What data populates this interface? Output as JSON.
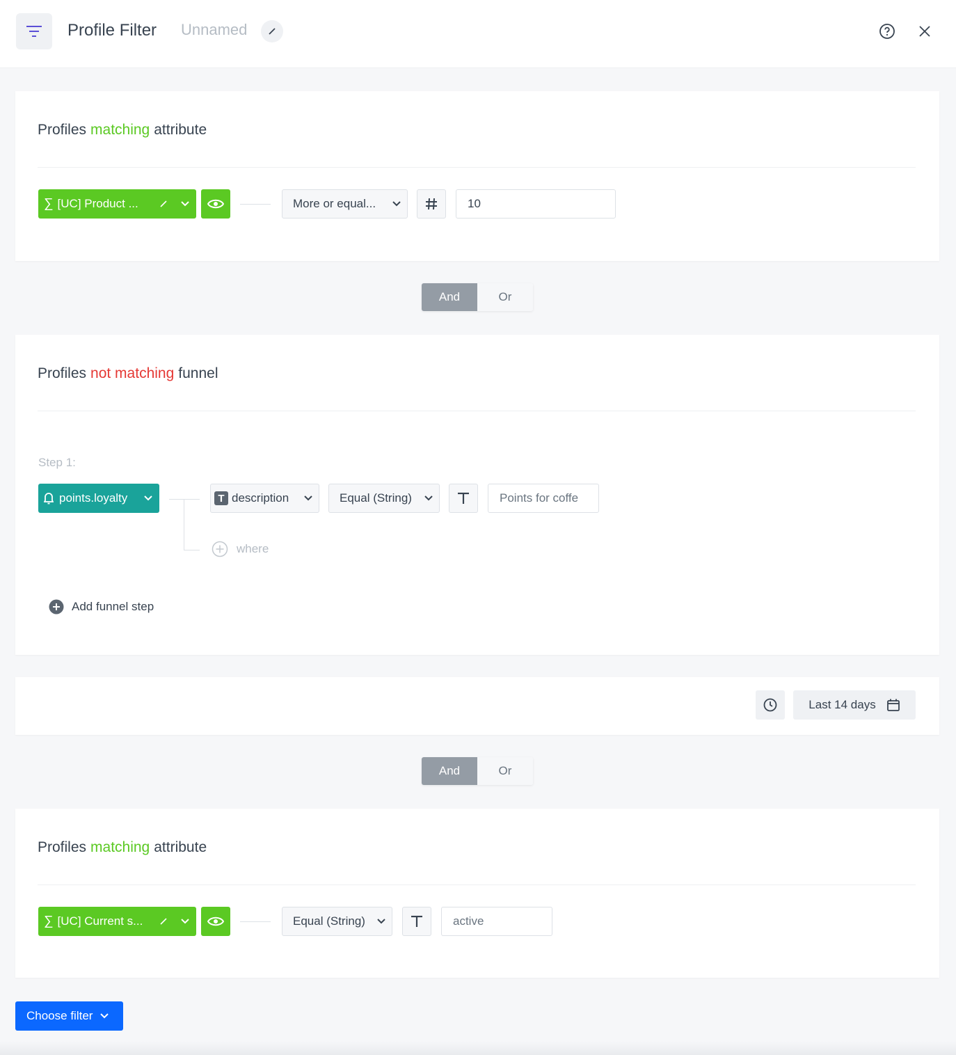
{
  "header": {
    "title": "Profile Filter",
    "name": "Unnamed"
  },
  "conditions": [
    {
      "prefix": "Profiles",
      "keyword": "matching",
      "suffix": "attribute",
      "attribute_label": "[UC] Product ...",
      "operator": "More or equal...",
      "value": "10"
    },
    {
      "prefix": "Profiles",
      "keyword": "not matching",
      "suffix": "funnel",
      "step_label": "Step 1:",
      "event_label": "points.loyalty",
      "param_label": "description",
      "operator": "Equal (String)",
      "value": "Points for coffe",
      "where_label": "where",
      "add_step_label": "Add funnel step",
      "date_range": "Last 14 days"
    },
    {
      "prefix": "Profiles",
      "keyword": "matching",
      "suffix": "attribute",
      "attribute_label": "[UC] Current s...",
      "operator": "Equal (String)",
      "value": "active"
    }
  ],
  "logic": [
    {
      "and_label": "And",
      "or_label": "Or",
      "selected": "And"
    },
    {
      "and_label": "And",
      "or_label": "Or",
      "selected": "And"
    }
  ],
  "footer": {
    "choose_filter_label": "Choose filter"
  },
  "colors": {
    "matching": "#5bc923",
    "not_matching": "#e53935",
    "attribute_pill": "#5bc923",
    "event_pill": "#1aa39a",
    "primary_button": "#0b68ff"
  }
}
